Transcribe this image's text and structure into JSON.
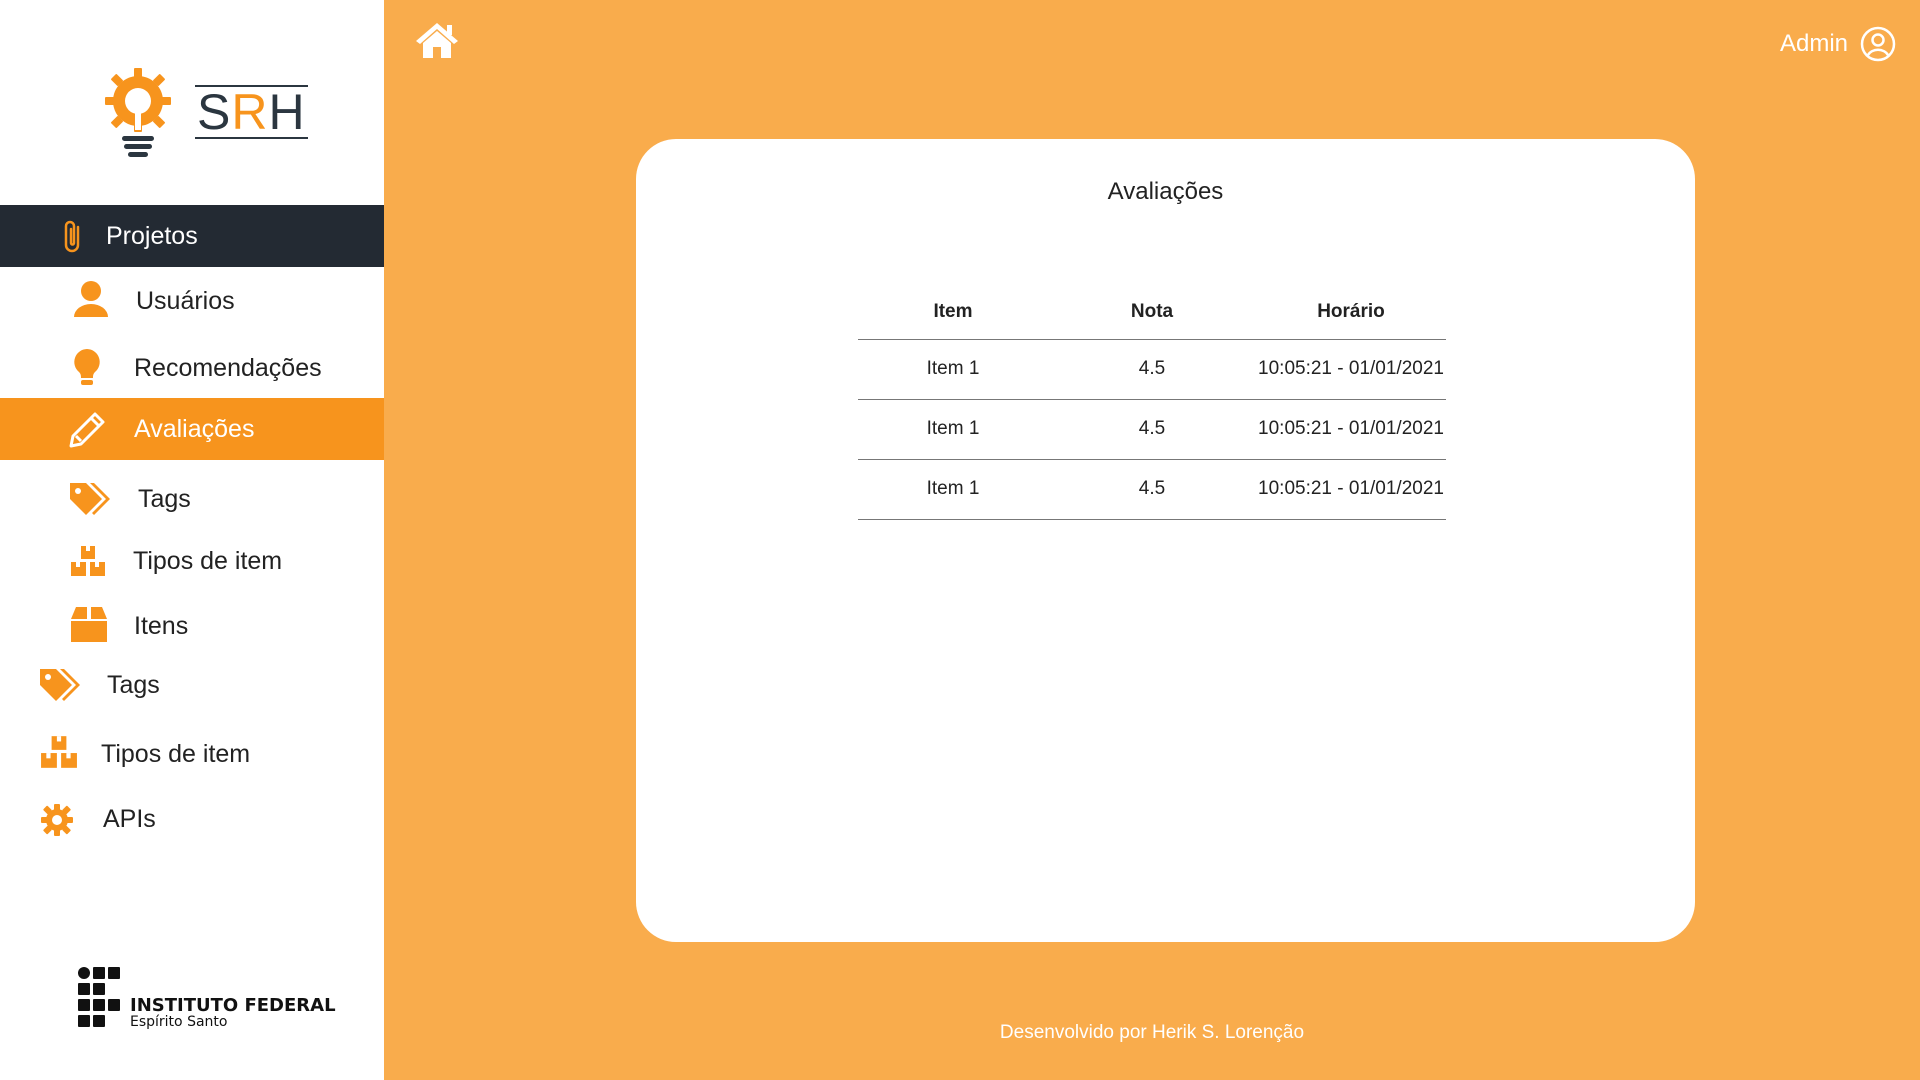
{
  "app": {
    "logo_text_s": "S",
    "logo_text_r": "R",
    "logo_text_h": "H"
  },
  "colors": {
    "accent": "#f7941d",
    "background": "#f9ac4c",
    "sidebar_dark": "#232a33"
  },
  "sidebar": {
    "items": [
      {
        "label": "Projetos",
        "icon": "paperclip-icon"
      },
      {
        "label": "Usuários",
        "icon": "user-icon"
      },
      {
        "label": "Recomendações",
        "icon": "lightbulb-icon"
      },
      {
        "label": "Avaliações",
        "icon": "pencil-icon"
      },
      {
        "label": "Tags",
        "icon": "tags-icon"
      },
      {
        "label": "Tipos de item",
        "icon": "boxes-icon"
      },
      {
        "label": "Itens",
        "icon": "box-icon"
      },
      {
        "label": "Tags",
        "icon": "tags-icon"
      },
      {
        "label": "Tipos de item",
        "icon": "boxes-icon"
      },
      {
        "label": "APIs",
        "icon": "gear-icon"
      }
    ],
    "institution_line1": "INSTITUTO FEDERAL",
    "institution_line2": "Espírito Santo"
  },
  "header": {
    "user_label": "Admin"
  },
  "main": {
    "title": "Avaliações",
    "table": {
      "headers": [
        "Item",
        "Nota",
        "Horário"
      ],
      "rows": [
        [
          "Item 1",
          "4.5",
          "10:05:21 - 01/01/2021"
        ],
        [
          "Item 1",
          "4.5",
          "10:05:21 - 01/01/2021"
        ],
        [
          "Item 1",
          "4.5",
          "10:05:21 - 01/01/2021"
        ]
      ]
    }
  },
  "footer": {
    "text": "Desenvolvido por Herik S. Lorenção"
  }
}
